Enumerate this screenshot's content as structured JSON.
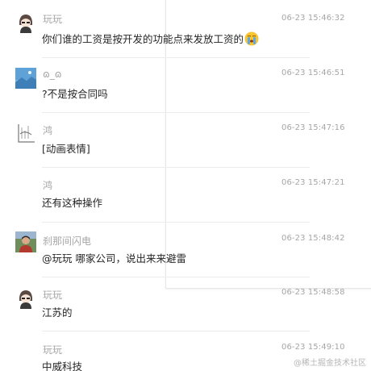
{
  "messages": [
    {
      "name": "玩玩",
      "time": "06-23 15:46:32",
      "text": "你们谁的工资是按开发的功能点来发放工资的",
      "avatar": "girl-avatar",
      "emoji": "crying-emoji"
    },
    {
      "name": "ɷ_ɷ",
      "time": "06-23 15:46:51",
      "text": "?不是按合同吗",
      "avatar": "landscape-avatar"
    },
    {
      "name": "鸿",
      "time": "06-23 15:47:16",
      "text": "[动画表情]",
      "avatar": "sketch-avatar"
    },
    {
      "name": "鸿",
      "time": "06-23 15:47:21",
      "text": "还有这种操作"
    },
    {
      "name": "刹那间闪电",
      "time": "06-23 15:48:42",
      "text": "@玩玩 哪家公司，说出来来避雷",
      "avatar": "photo-avatar"
    },
    {
      "name": "玩玩",
      "time": "06-23 15:48:58",
      "text": "江苏的",
      "avatar": "girl-avatar"
    },
    {
      "name": "玩玩",
      "time": "06-23 15:49:10",
      "text": "中威科技"
    }
  ],
  "watermark": "@稀土掘金技术社区",
  "colors": {
    "name": "#a6a6a6",
    "time": "#a6a6a6",
    "text": "#262626",
    "divider": "#ececec"
  }
}
